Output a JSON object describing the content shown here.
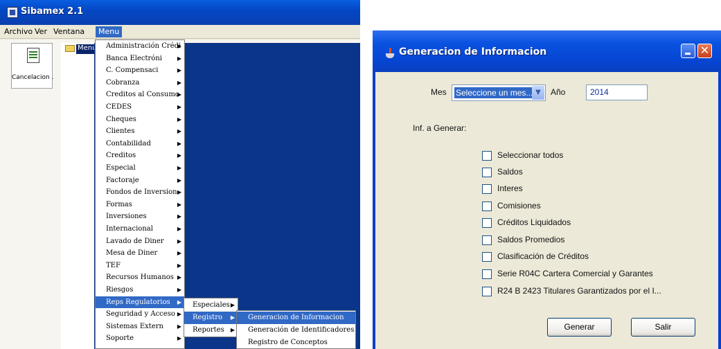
{
  "sibamex": {
    "title": "Sibamex 2.1",
    "menubar": [
      "Archivo",
      "Ver",
      "Ventana",
      "Menu"
    ],
    "shortcut_label": "Cancelacion ...",
    "tree_label": "Menu",
    "main_menu": [
      "Administración Crédi",
      "Banca Electróni",
      "C. Compensaci",
      "Cobranza",
      "Creditos al Consumo",
      "CEDES",
      "Cheques",
      "Clientes",
      "Contabilidad",
      "Creditos",
      "Especial",
      "Factoraje",
      "Fondos de Inversion",
      "Formas",
      "Inversiones",
      "Internacional",
      "Lavado de Diner",
      "Mesa de Diner",
      "TEF",
      "Recursos Humanos",
      "Riesgos",
      "Reps Regulatorios",
      "Seguridad y Acceso",
      "Sistemas Extern",
      "Soporte"
    ],
    "reps_submenu": [
      "Especiales",
      "Registro",
      "Reportes"
    ],
    "registro_submenu": [
      "Generacion de Informacion",
      "Generación de Identificadores",
      "Registro de Conceptos"
    ]
  },
  "dialog": {
    "title": "Generacion de Informacion",
    "mes_label": "Mes",
    "mes_value": "Seleccione un mes...",
    "ano_label": "Año",
    "ano_value": "2014",
    "inf_label": "Inf. a Generar:",
    "checkboxes": [
      "Seleccionar todos",
      "Saldos",
      "Interes",
      "Comisiones",
      "Créditos Liquidados",
      "Saldos Promedios",
      "Clasificación de Créditos",
      "Serie R04C Cartera Comercial y Garantes",
      "R24 B 2423 Titulares Garantizados por el I..."
    ],
    "generar_label": "Generar",
    "salir_label": "Salir"
  }
}
